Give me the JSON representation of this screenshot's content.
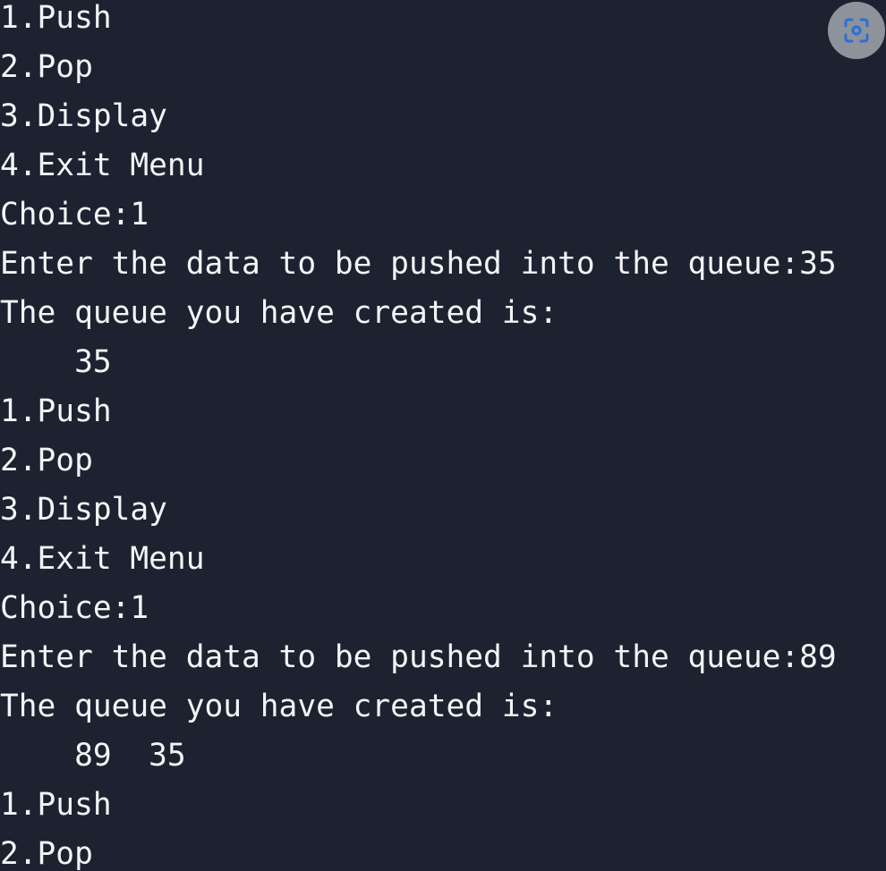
{
  "console": {
    "lines": [
      "1.Push",
      "2.Pop",
      "3.Display",
      "4.Exit Menu",
      "Choice:1",
      "Enter the data to be pushed into the queue:35",
      "The queue you have created is:",
      "    35",
      "1.Push",
      "2.Pop",
      "3.Display",
      "4.Exit Menu",
      "Choice:1",
      "Enter the data to be pushed into the queue:89",
      "The queue you have created is:",
      "    89  35",
      "1.Push",
      "2.Pop"
    ]
  },
  "overlay": {
    "icon": "lens-icon",
    "colors": {
      "button_bg": "#8d929b",
      "icon": "#2a6fd6"
    }
  },
  "theme": {
    "background": "#1d2230",
    "text": "#f3f4f6"
  }
}
